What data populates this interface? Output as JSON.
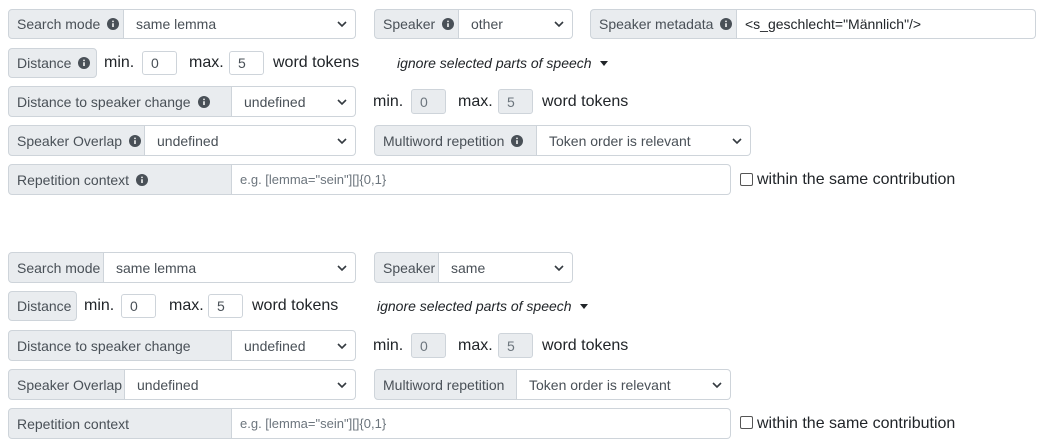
{
  "panel1": {
    "search_mode": {
      "label": "Search mode",
      "value": "same lemma"
    },
    "speaker": {
      "label": "Speaker",
      "value": "other"
    },
    "speaker_metadata": {
      "label": "Speaker metadata",
      "value": "<s_geschlecht=\"Männlich\"/>"
    },
    "distance": {
      "label": "Distance",
      "min_label": "min.",
      "min_value": "0",
      "max_label": "max.",
      "max_value": "5",
      "unit": "word tokens",
      "ignore_pos": "ignore selected parts of speech"
    },
    "speaker_change": {
      "label": "Distance to speaker change",
      "value": "undefined",
      "min_label": "min.",
      "min_value": "0",
      "max_label": "max.",
      "max_value": "5",
      "unit": "word tokens"
    },
    "overlap": {
      "label": "Speaker Overlap",
      "value": "undefined"
    },
    "multiword": {
      "label": "Multiword repetition",
      "value": "Token order is relevant"
    },
    "context": {
      "label": "Repetition context",
      "placeholder": "e.g. [lemma=\"sein\"][]{0,1}",
      "checkbox_label": "within the same contribution"
    }
  },
  "panel2": {
    "search_mode": {
      "label": "Search mode",
      "value": "same lemma"
    },
    "speaker": {
      "label": "Speaker",
      "value": "same"
    },
    "distance": {
      "label": "Distance",
      "min_label": "min.",
      "min_value": "0",
      "max_label": "max.",
      "max_value": "5",
      "unit": "word tokens",
      "ignore_pos": "ignore selected parts of speech"
    },
    "speaker_change": {
      "label": "Distance to speaker change",
      "value": "undefined",
      "min_label": "min.",
      "min_value": "0",
      "max_label": "max.",
      "max_value": "5",
      "unit": "word tokens"
    },
    "overlap": {
      "label": "Speaker Overlap",
      "value": "undefined"
    },
    "multiword": {
      "label": "Multiword repetition",
      "value": "Token order is relevant"
    },
    "context": {
      "label": "Repetition context",
      "placeholder": "e.g. [lemma=\"sein\"][]{0,1}",
      "checkbox_label": "within the same contribution"
    }
  }
}
